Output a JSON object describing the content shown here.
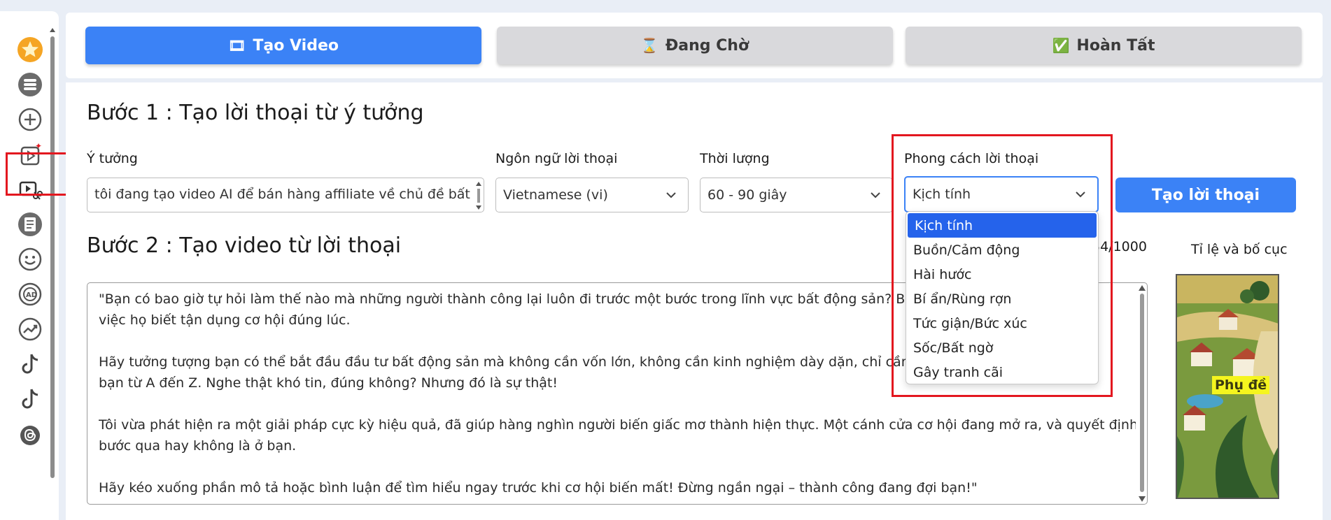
{
  "tabs": [
    {
      "label": "Tạo Video",
      "icon": "🎞",
      "active": true
    },
    {
      "label": "Đang Chờ",
      "icon": "⌛",
      "active": false
    },
    {
      "label": "Hoàn Tất",
      "icon": "✅",
      "active": false
    }
  ],
  "sidebar": {
    "items": [
      {
        "name": "star-icon"
      },
      {
        "name": "list-icon"
      },
      {
        "name": "add-icon"
      },
      {
        "name": "video-ai-icon",
        "highlighted": true
      },
      {
        "name": "video-edit-icon"
      },
      {
        "name": "document-icon"
      },
      {
        "name": "smiley-icon"
      },
      {
        "name": "ad-icon"
      },
      {
        "name": "trend-icon"
      },
      {
        "name": "tiktok-icon"
      },
      {
        "name": "tiktok-icon-2"
      },
      {
        "name": "threads-icon"
      }
    ]
  },
  "step1": {
    "title": "Bước 1 : Tạo lời thoại từ ý tưởng",
    "idea_label": "Ý tưởng",
    "idea_value": "tôi đang tạo video AI để bán hàng affiliate về chủ đề bất",
    "language_label": "Ngôn ngữ lời thoại",
    "language_value": "Vietnamese (vi)",
    "duration_label": "Thời lượng",
    "duration_value": "60 - 90 giây",
    "style_label": "Phong cách lời thoại",
    "style_value": "Kịch tính",
    "generate_button": "Tạo lời thoại"
  },
  "style_options": [
    "Kịch tính",
    "Buồn/Cảm động",
    "Hài hước",
    "Bí ẩn/Rùng rợn",
    "Tức giận/Bức xúc",
    "Sốc/Bất ngờ",
    "Gây tranh cãi"
  ],
  "step2": {
    "title": "Bước 2 : Tạo video từ lời thoại",
    "counter": "54/1000",
    "ratio_label": "Tỉ lệ và bố cục",
    "subtitle_badge": "Phụ đề",
    "script_lines": [
      "\"Bạn có bao giờ tự hỏi làm thế nào mà những người thành công lại luôn đi trước một bước trong lĩnh vực bất động sản? Bí mật nằm ở",
      "việc họ biết tận dụng cơ hội đúng lúc.",
      "",
      "Hãy tưởng tượng bạn có thể bắt đầu đầu tư bất động sản mà không cần vốn lớn, không cần kinh nghiệm dày dặn, chỉ cần một công cụ hỗ trợ",
      "bạn từ A đến Z. Nghe thật khó tin, đúng không? Nhưng đó là sự thật!",
      "",
      "Tôi vừa phát hiện ra một giải pháp cực kỳ hiệu quả, đã giúp hàng nghìn người biến giấc mơ thành hiện thực. Một cánh cửa cơ hội đang mở ra, và quyết định có",
      "bước qua hay không là ở bạn.",
      "",
      "Hãy kéo xuống phần mô tả hoặc bình luận để tìm hiểu ngay trước khi cơ hội biến mất! Đừng ngần ngại – thành công đang đợi bạn!\""
    ]
  },
  "colors": {
    "accent": "#3b82f6",
    "highlight_red": "#e3171f",
    "background": "#e9eef6"
  }
}
